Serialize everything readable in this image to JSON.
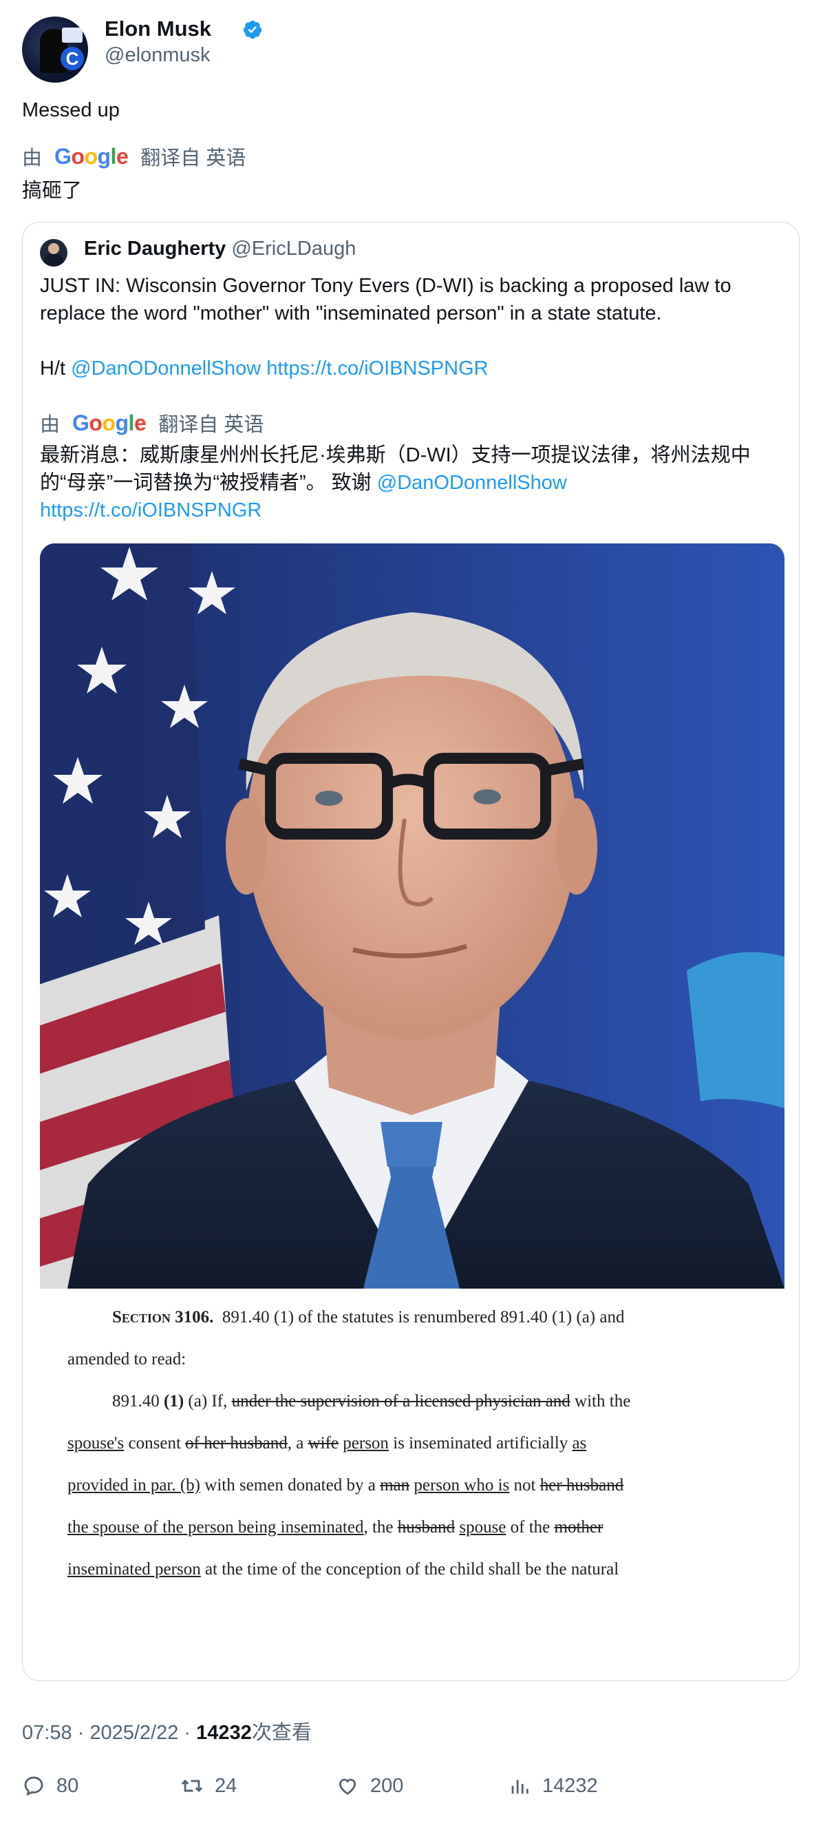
{
  "author": {
    "name": "Elon Musk",
    "handle": "@elonmusk",
    "verified": true,
    "verified_color": "#1d9bf0"
  },
  "tweet": {
    "text": "Messed up",
    "translate_by": "由",
    "translate_brand": "Google",
    "translate_from": "翻译自 英语",
    "translated_text": "搞砸了"
  },
  "quote": {
    "author_name": "Eric Daugherty",
    "author_handle": "@EricLDaugh",
    "text_line1": "JUST IN: Wisconsin Governor Tony Evers (D-WI) is backing a proposed law to replace the word \"mother\" with \"inseminated person\" in a state statute.",
    "ht_prefix": "H/t",
    "ht_mention": "@DanODonnellShow",
    "ht_link": "https://t.co/iOIBNSPNGR",
    "translate_by": "由",
    "translate_brand": "Google",
    "translate_from": "翻译自 英语",
    "translated_text": "最新消息：威斯康星州州长托尼·埃弗斯（D-WI）支持一项提议法律，将州法规中的“母亲”一词替换为“被授精者”。 致谢",
    "translated_mention": "@DanODonnellShow",
    "translated_link": "https://t.co/iOIBNSPNGR",
    "document": {
      "line1_section": "Section 3106.",
      "line1_rest": "891.40 (1) of the statutes is renumbered 891.40 (1) (a) and",
      "line2": "amended to read:",
      "line3_a": "891.40",
      "line3_b": "(1)",
      "line3_c": "(a)  If,",
      "line3_strike": "under the supervision of a licensed physician and",
      "line3_d": "with the",
      "line4_u1": "spouse's",
      "line4_a": "consent",
      "line4_s1": "of her husband",
      "line4_b": ", a",
      "line4_s2": "wife",
      "line4_u2": "person",
      "line4_c": "is inseminated artificially",
      "line4_u3": "as",
      "line5_u1": "provided in par. (b)",
      "line5_a": "with semen donated by a",
      "line5_s1": "man",
      "line5_u2": "person who is",
      "line5_b": "not",
      "line5_s2": "her husband",
      "line6_u1": "the spouse of the person being inseminated",
      "line6_a": ", the",
      "line6_s1": "husband",
      "line6_u2": "spouse",
      "line6_b": "of the",
      "line6_s2": "mother",
      "line7_u1": "inseminated person",
      "line7_a": "at the time of the conception of the child shall be the natural"
    }
  },
  "meta": {
    "time": "07:58",
    "date": "2025/2/22",
    "views": "14232",
    "views_label": "次查看"
  },
  "actions": {
    "replies": "80",
    "reposts": "24",
    "likes": "200",
    "views": "14232"
  },
  "colors": {
    "link": "#1d9bf0",
    "secondary": "#536471",
    "border": "#cfd9de"
  }
}
